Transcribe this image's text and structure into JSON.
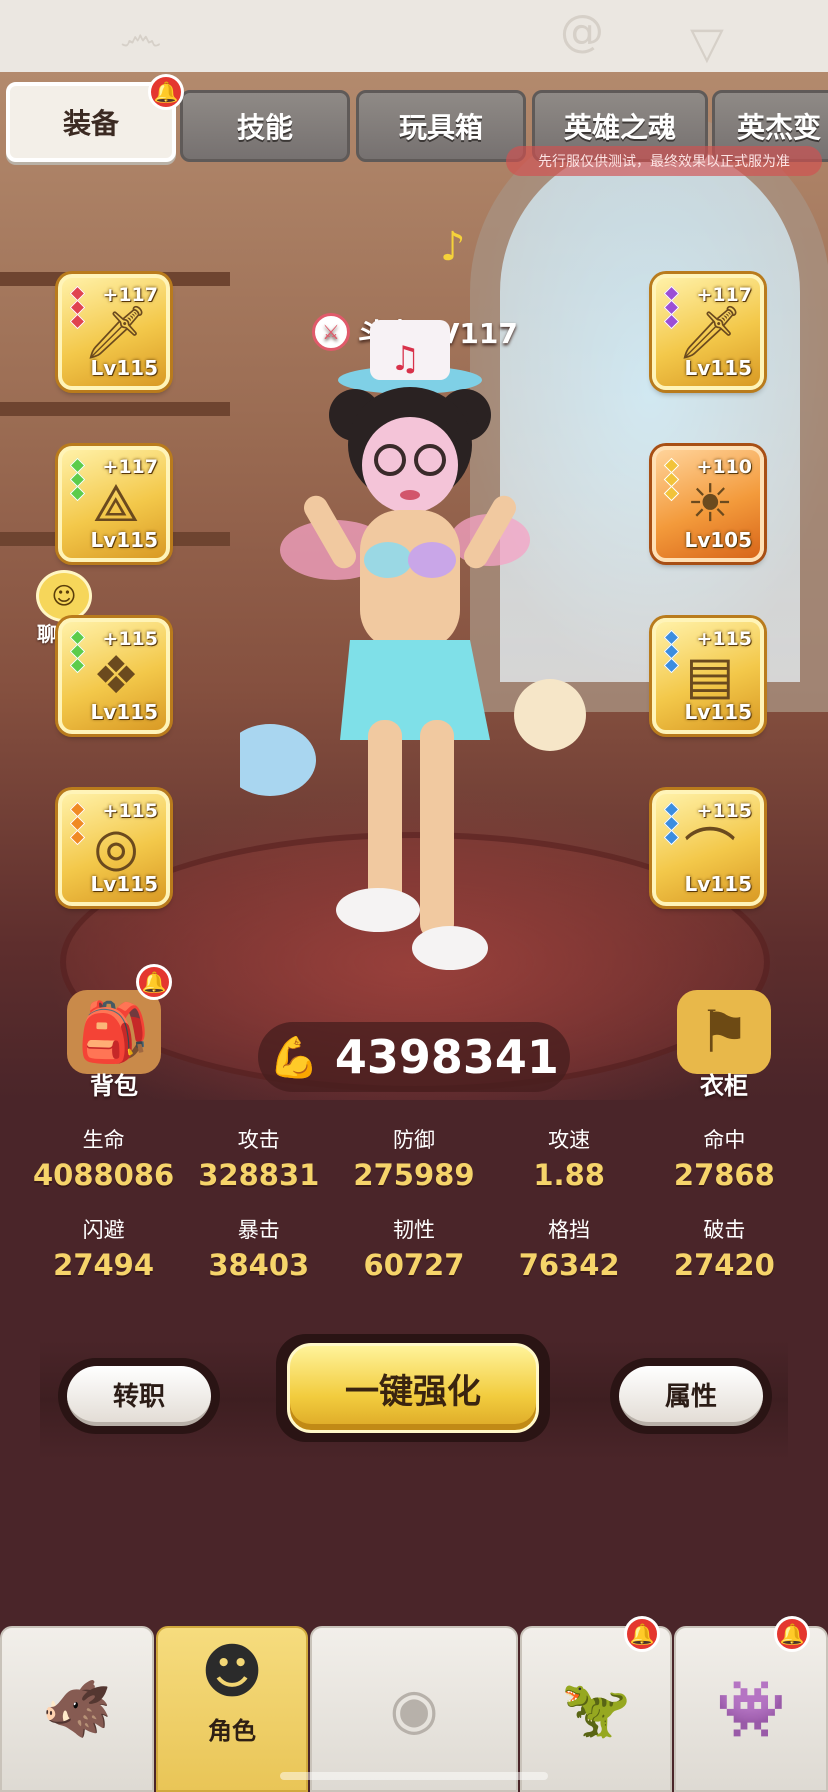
{
  "tabs": [
    {
      "label": "装备",
      "active": true,
      "notify": true
    },
    {
      "label": "技能",
      "active": false
    },
    {
      "label": "玩具箱",
      "active": false
    },
    {
      "label": "英雄之魂",
      "active": false
    },
    {
      "label": "英杰变",
      "active": false
    }
  ],
  "notice": "先行服仅供测试，最终效果以正式服为准",
  "character": {
    "name_level": "斗士 LV117"
  },
  "chat_label": "聊天",
  "left_slots": [
    {
      "plus": "+117",
      "level": "Lv115",
      "icon": "sword-icon",
      "gem_color": "#e0434f"
    },
    {
      "plus": "+117",
      "level": "Lv115",
      "icon": "bracer-icon",
      "gem_color": "#5ccc4b"
    },
    {
      "plus": "+115",
      "level": "Lv115",
      "icon": "belt-icon",
      "gem_color": "#5ccc4b"
    },
    {
      "plus": "+115",
      "level": "Lv115",
      "icon": "ring-icon",
      "gem_color": "#f08a24"
    }
  ],
  "right_slots": [
    {
      "plus": "+117",
      "level": "Lv115",
      "icon": "sword-icon",
      "gem_color": "#9b4fd6"
    },
    {
      "plus": "+110",
      "level": "Lv105",
      "icon": "mask-icon",
      "gem_color": "#f2c33a",
      "rarity": "orange"
    },
    {
      "plus": "+115",
      "level": "Lv115",
      "icon": "boots-icon",
      "gem_color": "#3b8de0"
    },
    {
      "plus": "+115",
      "level": "Lv115",
      "icon": "necklace-icon",
      "gem_color": "#3b8de0"
    }
  ],
  "backpack_label": "背包",
  "wardrobe_label": "衣柜",
  "power": "4398341",
  "stats": [
    [
      {
        "label": "生命",
        "value": "4088086"
      },
      {
        "label": "攻击",
        "value": "328831"
      },
      {
        "label": "防御",
        "value": "275989"
      },
      {
        "label": "攻速",
        "value": "1.88"
      },
      {
        "label": "命中",
        "value": "27868"
      }
    ],
    [
      {
        "label": "闪避",
        "value": "27494"
      },
      {
        "label": "暴击",
        "value": "38403"
      },
      {
        "label": "韧性",
        "value": "60727"
      },
      {
        "label": "格挡",
        "value": "76342"
      },
      {
        "label": "破击",
        "value": "27420"
      }
    ]
  ],
  "buttons": {
    "transfer": "转职",
    "enhance": "一键强化",
    "attributes": "属性"
  },
  "nav": [
    {
      "label": "",
      "icon": "beast-icon",
      "notify": false
    },
    {
      "label": "角色",
      "icon": "character-icon",
      "active": true,
      "notify": false
    },
    {
      "label": "",
      "icon": "spiral-icon",
      "notify": false
    },
    {
      "label": "",
      "icon": "creature-icon",
      "notify": true
    },
    {
      "label": "",
      "icon": "monster-icon",
      "notify": true
    }
  ]
}
